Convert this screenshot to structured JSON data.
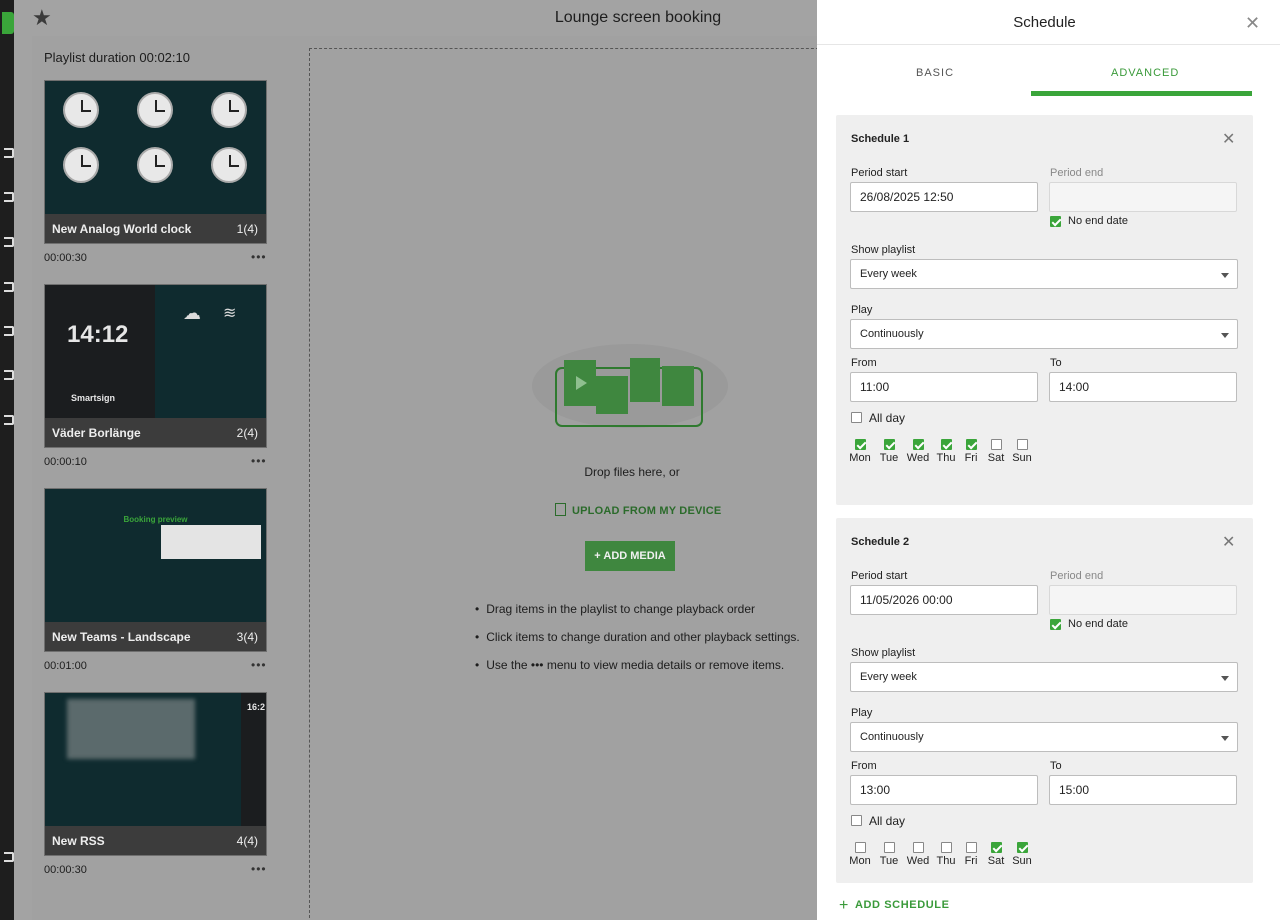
{
  "app": {
    "title": "Lounge screen booking",
    "playlist_duration": "Playlist duration 00:02:10"
  },
  "playlist": [
    {
      "name": "New Analog World clock",
      "count": "1(4)",
      "duration": "00:00:30"
    },
    {
      "name": "Väder Borlänge",
      "count": "2(4)",
      "duration": "00:00:10",
      "thumb_time": "14:12",
      "thumb_brand": "Smartsign"
    },
    {
      "name": "New Teams - Landscape",
      "count": "3(4)",
      "duration": "00:01:00",
      "thumb_heading": "Booking preview"
    },
    {
      "name": "New RSS",
      "count": "4(4)",
      "duration": "00:00:30",
      "thumb_time": "16:2"
    }
  ],
  "dropzone": {
    "text": "Drop files here, or",
    "upload_label": "UPLOAD FROM MY DEVICE",
    "add_media_label": "+ ADD MEDIA",
    "hints": [
      "Drag items in the playlist to change playback order",
      "Click items to change duration and other playback settings.",
      "Use the ••• menu to view media details or remove items."
    ]
  },
  "panel": {
    "title": "Schedule",
    "tabs": [
      "BASIC",
      "ADVANCED"
    ],
    "active_tab": "ADVANCED",
    "add_schedule_label": "ADD SCHEDULE"
  },
  "labels": {
    "period_start": "Period start",
    "period_end": "Period end",
    "no_end_date": "No end date",
    "show_playlist": "Show playlist",
    "play": "Play",
    "from": "From",
    "to": "To",
    "all_day": "All day"
  },
  "days": [
    "Mon",
    "Tue",
    "Wed",
    "Thu",
    "Fri",
    "Sat",
    "Sun"
  ],
  "schedules": [
    {
      "title": "Schedule 1",
      "period_start": "26/08/2025 12:50",
      "period_end": "",
      "no_end_date": true,
      "show_playlist": "Every week",
      "play": "Continuously",
      "from": "11:00",
      "to": "14:00",
      "all_day": false,
      "days_checked": [
        true,
        true,
        true,
        true,
        true,
        false,
        false
      ]
    },
    {
      "title": "Schedule 2",
      "period_start": "11/05/2026 00:00",
      "period_end": "",
      "no_end_date": true,
      "show_playlist": "Every week",
      "play": "Continuously",
      "from": "13:00",
      "to": "15:00",
      "all_day": false,
      "days_checked": [
        false,
        false,
        false,
        false,
        false,
        true,
        true
      ]
    }
  ],
  "colors": {
    "accent": "#3aa53a",
    "overlay": "#a3a3a3",
    "panel": "#ffffff",
    "thumb_bg": "#0f2b2f"
  }
}
